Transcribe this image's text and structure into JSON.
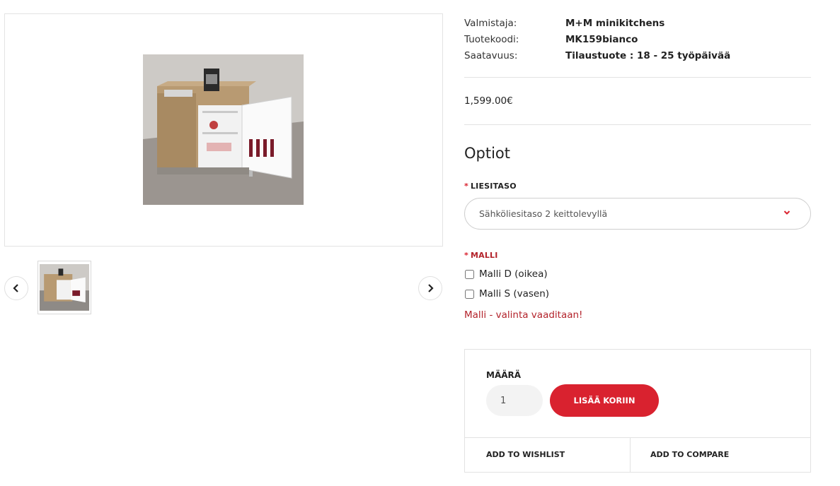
{
  "specs": [
    {
      "label": "Valmistaja:",
      "value": "M+M minikitchens"
    },
    {
      "label": "Tuotekoodi:",
      "value": "MK159bianco"
    },
    {
      "label": "Saatavuus:",
      "value": "Tilaustuote : 18 - 25 työpäivää"
    }
  ],
  "price": "1,599.00€",
  "options_title": "Optiot",
  "liesitaso": {
    "label": "LIESITASO",
    "selected": "Sähköliesitaso 2 keittolevyllä"
  },
  "malli": {
    "label": "MALLI",
    "choices": [
      "Malli D (oikea)",
      "Malli S (vasen)"
    ],
    "error": "Malli - valinta vaaditaan!"
  },
  "required_mark": "*",
  "cart": {
    "qty_label": "MÄÄRÄ",
    "qty_value": "1",
    "add_label": "LISÄÄ KORIIN",
    "wishlist_label": "ADD TO WISHLIST",
    "compare_label": "ADD TO COMPARE"
  },
  "colors": {
    "accent": "#d9222f",
    "error": "#b3232b"
  }
}
